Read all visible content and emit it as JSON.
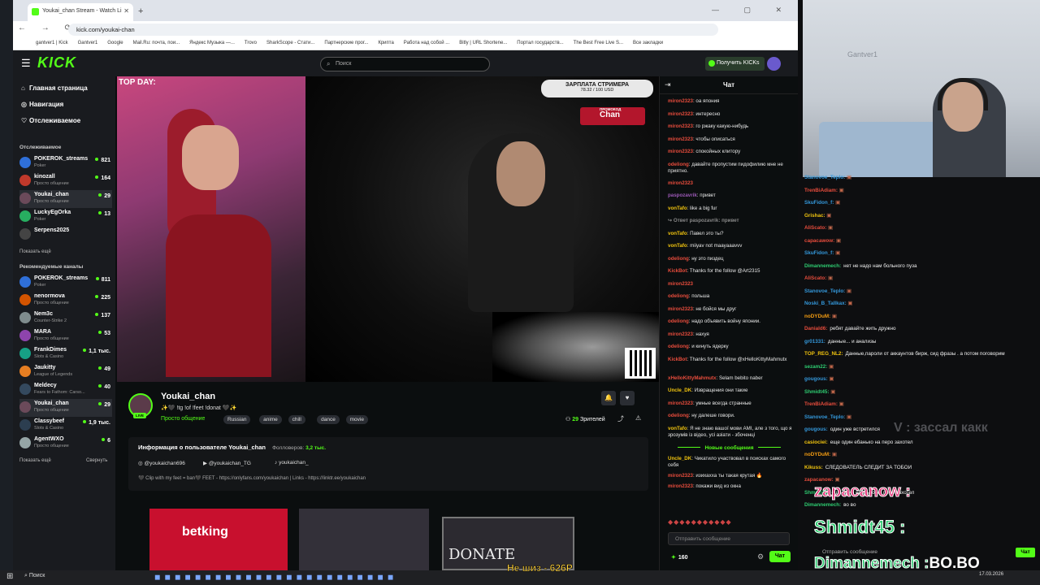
{
  "browser": {
    "tab_title": "Youkai_chan Stream - Watch Li",
    "new_tab": "+",
    "window_controls": "— ▢ ✕",
    "nav_glyphs": "← → ⟳",
    "url": "kick.com/youkai-chan",
    "bookmarks": [
      "gantver1 | Kick",
      "Gantver1",
      "Google",
      "Mail.Ru: почта, пои...",
      "Яндекс Музыка —...",
      "Trovo",
      "SharkScope - Стати...",
      "Партнерские прог...",
      "Крипта",
      "Работа над собой ...",
      "Bitly | URL Shortene...",
      "Портал государств...",
      "The Best Free Live S...",
      "Все закладки"
    ]
  },
  "kick": {
    "logo": "KICK",
    "search_placeholder": "Поиск",
    "get_kicks": "Получить KICKs"
  },
  "sidebar": {
    "nav": [
      {
        "icon": "⌂",
        "label": "Главная страница"
      },
      {
        "icon": "◎",
        "label": "Навигация"
      },
      {
        "icon": "♡",
        "label": "Отслеживаемое"
      }
    ],
    "followed_header": "Отслеживаемое",
    "followed": [
      {
        "name": "POKEROK_streams",
        "cat": "Poker",
        "viewers": "821",
        "color": "#2f6fd8"
      },
      {
        "name": "kinozall",
        "cat": "Просто общение",
        "viewers": "164",
        "color": "#c0392b"
      },
      {
        "name": "Youkai_chan",
        "cat": "Просто общение",
        "viewers": "29",
        "color": "#6b4a5a"
      },
      {
        "name": "LuckyEgOrka",
        "cat": "Poker",
        "viewers": "13",
        "color": "#27ae60"
      },
      {
        "name": "Serpens2025",
        "cat": "",
        "viewers": "",
        "color": "#444"
      }
    ],
    "show_more": "Показать ещё",
    "recommended_header": "Рекомендуемые каналы",
    "recommended": [
      {
        "name": "POKEROK_streams",
        "cat": "Poker",
        "viewers": "811",
        "color": "#2f6fd8"
      },
      {
        "name": "nenormova",
        "cat": "Просто общение",
        "viewers": "225",
        "color": "#d35400"
      },
      {
        "name": "Nem3c",
        "cat": "Counter-Strike 2",
        "viewers": "137",
        "color": "#7f8c8d"
      },
      {
        "name": "MARA",
        "cat": "Просто общение",
        "viewers": "53",
        "color": "#8e44ad"
      },
      {
        "name": "FrankDimes",
        "cat": "Slots & Casino",
        "viewers": "1,1 тыс.",
        "color": "#16a085"
      },
      {
        "name": "Jaukitty",
        "cat": "League of Legends",
        "viewers": "49",
        "color": "#e67e22"
      },
      {
        "name": "Meldecy",
        "cat": "Fears to Fathom: Carso...",
        "viewers": "40",
        "color": "#34495e"
      },
      {
        "name": "Youkai_chan",
        "cat": "Просто общение",
        "viewers": "29",
        "color": "#6b4a5a"
      },
      {
        "name": "Classybeef",
        "cat": "Slots & Casino",
        "viewers": "1,9 тыс.",
        "color": "#2c3e50"
      },
      {
        "name": "AgentWXO",
        "cat": "Просто общение",
        "viewers": "6",
        "color": "#95a5a6"
      }
    ],
    "show_more2": "Показать ещё",
    "collapse": "Свернуть"
  },
  "video": {
    "overlay_top": "TOP DAY:",
    "salary_title": "ЗАРПЛАТА СТРИМЕРА",
    "salary_progress": "78.32 / 100 USD",
    "promo_label": "ПРОМОКОД",
    "promo_code": "Chan"
  },
  "channel": {
    "name": "Youkai_chan",
    "live": "LIVE",
    "title": "✨🖤 !tg !of !feet !donat 🖤✨",
    "category": "Просто общение",
    "tags": [
      "Russian",
      "anime",
      "chill",
      "dance",
      "movie"
    ],
    "viewers_count": "29",
    "viewers_label": "Зрителей",
    "about_title": "Информация о пользователе Youkai_chan",
    "followers_label": "Фолловеров:",
    "followers": "3,2 тыс.",
    "socials": [
      "@youkaichan696",
      "@youkaichan_TG",
      "youkaichan_"
    ],
    "about_text": "🖤 Clip with my feet = ban🖤 FEET - https://onlyfans.com/youkaichan | Links - https://linktr.ee/youkaichan",
    "panel1": "betking",
    "panel3": "DONATE"
  },
  "chat": {
    "title": "Чат",
    "messages": [
      {
        "u": "miron2323",
        "c": "#e74c3c",
        "t": "оа япония"
      },
      {
        "u": "miron2323",
        "c": "#e74c3c",
        "t": "интересно"
      },
      {
        "u": "miron2323",
        "c": "#e74c3c",
        "t": "го ржаку какую-нибудь"
      },
      {
        "u": "miron2323",
        "c": "#e74c3c",
        "t": "чтобы описаться"
      },
      {
        "u": "miron2323",
        "c": "#e74c3c",
        "t": "спокойных клитору"
      },
      {
        "u": "odeliong",
        "c": "#e74c3c",
        "t": "давайте пропустим пидофилию мне не приятно."
      },
      {
        "u": "miron2323",
        "c": "#e74c3c",
        "t": ""
      },
      {
        "u": "paspozavrik",
        "c": "#9b59b6",
        "t": "привет"
      },
      {
        "u": "vonTafo",
        "c": "#f1c40f",
        "t": "like a big fur"
      },
      {
        "u": "↪ Ответ paspozavrik: привет",
        "c": "#888",
        "t": ""
      },
      {
        "u": "vonTafo",
        "c": "#f1c40f",
        "t": "Павел это ты?"
      },
      {
        "u": "vonTafo",
        "c": "#f1c40f",
        "t": "miiyav not maayaaavvv"
      },
      {
        "u": "odeliong",
        "c": "#e74c3c",
        "t": "ну это пиздец"
      },
      {
        "u": "KickBot",
        "c": "#e74c3c",
        "t": "Thanks for the follow @Art2315"
      },
      {
        "u": "miron2323",
        "c": "#e74c3c",
        "t": ""
      },
      {
        "u": "odeliong",
        "c": "#e74c3c",
        "t": "польша"
      },
      {
        "u": "miron2323",
        "c": "#e74c3c",
        "t": "не бойся мы друг"
      },
      {
        "u": "odeliong",
        "c": "#e74c3c",
        "t": "надо объявить войну японии."
      },
      {
        "u": "miron2323",
        "c": "#e74c3c",
        "t": "нахуя"
      },
      {
        "u": "odeliong",
        "c": "#e74c3c",
        "t": "и кинуть ядерку"
      },
      {
        "u": "KickBot",
        "c": "#e74c3c",
        "t": "Thanks for the follow @xHelloKittyMahmutx"
      },
      {
        "u": "xHelloKittyMahmutx",
        "c": "#e74c3c",
        "t": "Selam bebito naber"
      },
      {
        "u": "Uncle_DK",
        "c": "#f1c40f",
        "t": "Извращения они такие"
      },
      {
        "u": "miron2323",
        "c": "#e74c3c",
        "t": "умные всегда странные"
      },
      {
        "u": "odeliong",
        "c": "#e74c3c",
        "t": "ну далеше говори."
      },
      {
        "u": "vonTafo",
        "c": "#f1c40f",
        "t": "Я не знаю вашої мови АМІ, але з того, що я зрозумів із відео, усі азіати - збоченці"
      }
    ],
    "new_messages": "Новые сообщения",
    "after": [
      {
        "u": "Uncle_DK",
        "c": "#f1c40f",
        "t": "Чикатило участвовал в поисках самого себя"
      },
      {
        "u": "miron2323",
        "c": "#e74c3c",
        "t": "изихахха ты такая крутая 🔥"
      },
      {
        "u": "miron2323",
        "c": "#e74c3c",
        "t": "покажи вид из окна"
      }
    ],
    "emotes": "◆◆◆◆◆◆◆◆◆◆◆",
    "input_placeholder": "Отправить сообщение",
    "points": "160",
    "send": "Чат"
  },
  "overlay": {
    "watermark": "Gantver1",
    "messages": [
      {
        "u": "Stanovoe_Teplo:",
        "c": "#3498db",
        "t": ""
      },
      {
        "u": "TrenBiAdiam:",
        "c": "#e74c3c",
        "t": ""
      },
      {
        "u": "SkuFidon_f:",
        "c": "#3498db",
        "t": ""
      },
      {
        "u": "Grishac:",
        "c": "#f1c40f",
        "t": ""
      },
      {
        "u": "AliScato:",
        "c": "#e74c3c",
        "t": ""
      },
      {
        "u": "сарасаwow:",
        "c": "#e74c3c",
        "t": ""
      },
      {
        "u": "SkuFidon_f:",
        "c": "#3498db",
        "t": ""
      },
      {
        "u": "Dimannemech:",
        "c": "#2ecc71",
        "t": "нет не надо нам больного пуза"
      },
      {
        "u": "AliScato:",
        "c": "#e74c3c",
        "t": ""
      },
      {
        "u": "Stanovoe_Teplo:",
        "c": "#3498db",
        "t": ""
      },
      {
        "u": "Noski_B_Tallkax:",
        "c": "#3498db",
        "t": ""
      },
      {
        "u": "noDYDuM:",
        "c": "#f39c12",
        "t": ""
      },
      {
        "u": "Daniald6:",
        "c": "#e74c3c",
        "t": "ребят давайте жить дружно"
      },
      {
        "u": "gr01331:",
        "c": "#3498db",
        "t": "данные... и анализы"
      },
      {
        "u": "TOP_REG_NL2:",
        "c": "#f1c40f",
        "t": "Данные,пароли от аккаунтов бирж, сид фразы . а потом поговорим"
      },
      {
        "u": "sezam22:",
        "c": "#2ecc71",
        "t": ""
      },
      {
        "u": "gougous:",
        "c": "#3498db",
        "t": ""
      },
      {
        "u": "Shmidt45:",
        "c": "#2ecc71",
        "t": ""
      },
      {
        "u": "TrenBiAdiam:",
        "c": "#e74c3c",
        "t": ""
      },
      {
        "u": "Stanovoe_Teplo:",
        "c": "#3498db",
        "t": ""
      },
      {
        "u": "gougous:",
        "c": "#3498db",
        "t": "один уже встретился"
      },
      {
        "u": "casiociei:",
        "c": "#f1c40f",
        "t": "еще один ебанько на перо захотел"
      },
      {
        "u": "noDYDuM:",
        "c": "#f39c12",
        "t": ""
      },
      {
        "u": "Kikuss:",
        "c": "#f1c40f",
        "t": "СЛЕДОВАТЕЛЬ СЛЕДИТ ЗА ТОБОЙ"
      },
      {
        "u": "zapacanow:",
        "c": "#e74c3c",
        "t": ""
      },
      {
        "u": "Shmidt45:",
        "c": "#2ecc71",
        "t": "еще один ебанько на перо захотел"
      },
      {
        "u": "Dimannemech:",
        "c": "#2ecc71",
        "t": "во во"
      }
    ],
    "big1": "zapacanow :",
    "big2": "Shmidt45 :",
    "big3_name": "Dimannemech :",
    "big3_text": "BO.BO",
    "zassal": "V : засcал какк",
    "input": "Отправить сообщение",
    "send": "Чат"
  },
  "taskbar": {
    "search": "Поиск",
    "marquee": "Не шиз - 626Р",
    "time": "17.03.2026"
  }
}
